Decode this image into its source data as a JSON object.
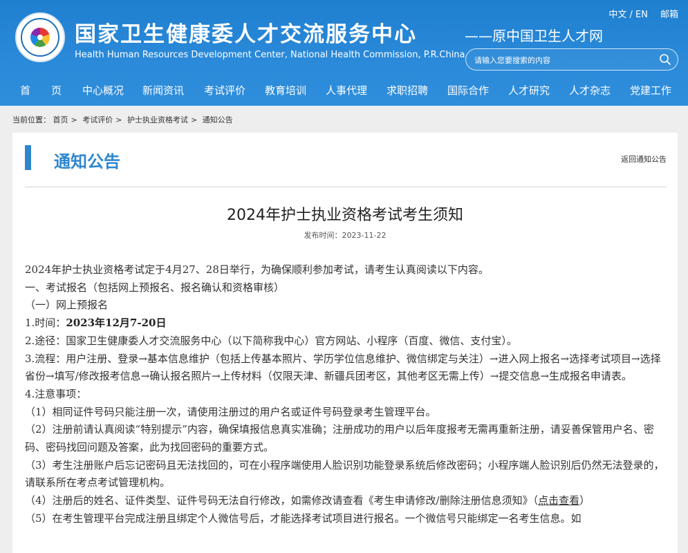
{
  "header": {
    "title_cn": "国家卫生健康委人才交流服务中心",
    "title_en": "Health Human Resources Development Center, National Health Commission, P.R.China",
    "old_name": "——原中国卫生人才网",
    "lang_label": "中文 / EN",
    "mail_label": "邮箱",
    "search_placeholder": "请输入您要搜索的内容",
    "logo_icon": "health-center-emblem"
  },
  "nav": {
    "items": [
      "首　　页",
      "中心概况",
      "新闻资讯",
      "考试评价",
      "教育培训",
      "人事代理",
      "求职招聘",
      "国际合作",
      "人才研究",
      "人才杂志",
      "党建工作"
    ]
  },
  "breadcrumb": {
    "prefix": "当前位置：",
    "items": [
      "首页",
      "考试评价",
      "护士执业资格考试",
      "通知公告"
    ],
    "separator": ">"
  },
  "section": {
    "title": "通知公告",
    "back_link": "返回通知公告"
  },
  "article": {
    "title": "2024年护士执业资格考试考生须知",
    "date_label": "发布时间：",
    "date": "2023-11-22",
    "p1": "2024年护士执业资格考试定于4月27、28日举行，为确保顺利参加考试，请考生认真阅读以下内容。",
    "p2": "一、考试报名（包括网上预报名、报名确认和资格审核）",
    "p3": "（一）网上预报名",
    "p4_prefix": "1.时间：",
    "p4_bold": "2023年12月7-20日",
    "p5": "2.途径：国家卫生健康委人才交流服务中心（以下简称我中心）官方网站、小程序（百度、微信、支付宝）。",
    "p6": "3.流程：用户注册、登录→基本信息维护（包括上传基本照片、学历学位信息维护、微信绑定与关注）→进入网上报名→选择考试项目→选择省份→填写/修改报考信息→确认报名照片→上传材料（仅限天津、新疆兵团考区，其他考区无需上传）→提交信息→生成报名申请表。",
    "p7": "4.注意事项：",
    "p8": "（1）相同证件号码只能注册一次，请使用注册过的用户名或证件号码登录考生管理平台。",
    "p9": "（2）注册前请认真阅读“特别提示”内容，确保填报信息真实准确；注册成功的用户以后年度报考无需再重新注册，请妥善保管用户名、密码、密码找回问题及答案，此为找回密码的重要方式。",
    "p10": "（3）考生注册账户后忘记密码且无法找回的，可在小程序端使用人脸识别功能登录系统后修改密码；小程序端人脸识别后仍然无法登录的，请联系所在考点考试管理机构。",
    "p11_prefix": "（4）注册后的姓名、证件类型、证件号码无法自行修改，如需修改请查看《考生申请修改/删除注册信息须知》（",
    "p11_link": "点击查看",
    "p11_suffix": "）",
    "p12": "（5）在考生管理平台完成注册且绑定个人微信号后，才能选择考试项目进行报名。一个微信号只能绑定一名考生信息。如"
  }
}
